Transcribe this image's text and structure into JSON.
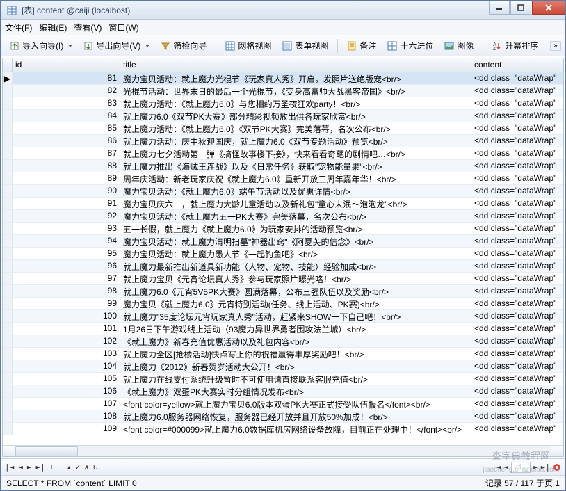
{
  "window": {
    "title": "[表] content @caiji (localhost)"
  },
  "menu": {
    "file": "文件(F)",
    "edit": "编辑(E)",
    "view": "查看(V)",
    "window": "窗口(W)"
  },
  "toolbar": {
    "import": "导入向导(I)",
    "export": "导出向导(V)",
    "filter": "筛检向导",
    "gridview": "网格视图",
    "formview": "表单视图",
    "memo": "备注",
    "hex": "十六进位",
    "image": "图像",
    "sort": "升幂排序"
  },
  "columns": {
    "id": "id",
    "title": "title",
    "content": "content"
  },
  "rows": [
    {
      "id": 81,
      "title": "魔力宝贝活动：就上魔力光棍节《玩家真人秀》开启，发照片送绝版宠<br/>",
      "content": "<dd class=\"dataWrap\""
    },
    {
      "id": 82,
      "title": "光棍节活动：世界末日的最后一个光棍节，《变身高富帅大战黑客帝国》<br/>",
      "content": "<dd class=\"dataWrap\""
    },
    {
      "id": 83,
      "title": "就上魔力活动：《就上魔力6.0》与您相约万圣夜狂欢party！<br/>",
      "content": "<dd class=\"dataWrap\""
    },
    {
      "id": 84,
      "title": "就上魔力6.0《双节PK大赛》部分精彩视频放出供各玩家欣赏<br/>",
      "content": "<dd class=\"dataWrap\""
    },
    {
      "id": 85,
      "title": "就上魔力活动：《就上魔力6.0》《双节PK大赛》完美落幕，名次公布<br/>",
      "content": "<dd class=\"dataWrap\""
    },
    {
      "id": 86,
      "title": "就上魔力活动：庆中秋迎国庆，就上魔力6.0《双节专题活动》预览<br/>",
      "content": "<dd class=\"dataWrap\""
    },
    {
      "id": 87,
      "title": "就上魔力七夕活动第一弹《搞怪故事楼下接》，快来看看奇葩的剧情吧…<br/>",
      "content": "<dd class=\"dataWrap\""
    },
    {
      "id": 88,
      "title": "就上魔力推出《海贼王连战》以及《日常任务》获取\"宠物能量果\"<br/>",
      "content": "<dd class=\"dataWrap\""
    },
    {
      "id": 89,
      "title": "周年庆活动：新老玩家庆祝《就上魔力6.0》重新开放三周年嘉年华！<br/>",
      "content": "<dd class=\"dataWrap\""
    },
    {
      "id": 90,
      "title": "魔力宝贝活动：《就上魔力6.0》端午节活动以及优惠详情<br/>",
      "content": "<dd class=\"dataWrap\""
    },
    {
      "id": 91,
      "title": "魔力宝贝庆六一，就上魔力大龄儿童活动以及新礼包\"童心未泯～泡泡龙\"<br/>",
      "content": "<dd class=\"dataWrap\""
    },
    {
      "id": 92,
      "title": "魔力宝贝活动：《就上魔力五一PK大赛》完美落幕，名次公布<br/>",
      "content": "<dd class=\"dataWrap\""
    },
    {
      "id": 93,
      "title": "五一长假，就上魔力《就上魔力6.0》为玩家安排的活动预览<br/>",
      "content": "<dd class=\"dataWrap\""
    },
    {
      "id": 94,
      "title": "魔力宝贝活动：就上魔力清明扫墓\"神器出窍\"《阿夏芙的信念》<br/>",
      "content": "<dd class=\"dataWrap\""
    },
    {
      "id": 95,
      "title": "魔力宝贝活动：就上魔力愚人节《一起钓鱼吧》<br/>",
      "content": "<dd class=\"dataWrap\""
    },
    {
      "id": 96,
      "title": "就上魔力最新推出新道具新功能（人物、宠物、技能）经验加成<br/>",
      "content": "<dd class=\"dataWrap\""
    },
    {
      "id": 97,
      "title": "就上魔力宝贝《元宵论坛真人秀》参与玩家照片曝光咯！<br/>",
      "content": "<dd class=\"dataWrap\""
    },
    {
      "id": 98,
      "title": "就上魔力6.0《元宵5V5PK大赛》圆满落幕，公布三强队伍以及奖励<br/>",
      "content": "<dd class=\"dataWrap\""
    },
    {
      "id": 99,
      "title": "魔力宝贝《就上魔力6.0》元宵特别活动(任务、线上活动、PK赛)<br/>",
      "content": "<dd class=\"dataWrap\""
    },
    {
      "id": 100,
      "title": "就上魔力\"35度论坛元宵玩家真人秀\"活动，赶紧来SHOW一下自己吧！<br/>",
      "content": "<dd class=\"dataWrap\""
    },
    {
      "id": 101,
      "title": "1月26日下午游戏线上活动（93魔力异世界勇者围攻法兰城）<br/>",
      "content": "<dd class=\"dataWrap\""
    },
    {
      "id": 102,
      "title": "《就上魔力》新春充值优惠活动以及礼包内容<br/>",
      "content": "<dd class=\"dataWrap\""
    },
    {
      "id": 103,
      "title": "就上魔力全区[抢楼活动]快点写上你的祝福赢得丰厚奖励吧！<br/>",
      "content": "<dd class=\"dataWrap\""
    },
    {
      "id": 104,
      "title": "就上魔力《2012》新春贺岁活动大公开！<br/>",
      "content": "<dd class=\"dataWrap\""
    },
    {
      "id": 105,
      "title": "就上魔力在线支付系统升级暂时不可使用请直接联系客服充值<br/>",
      "content": "<dd class=\"dataWrap\""
    },
    {
      "id": 106,
      "title": "《就上魔力》双蛋PK大赛实时分组情况发布<br/>",
      "content": "<dd class=\"dataWrap\""
    },
    {
      "id": 107,
      "title": "<font color=yellow>就上魔力宝贝6.0版本双蛋PK大赛正式接受队伍报名</font><br/>",
      "content": "<dd class=\"dataWrap\""
    },
    {
      "id": 108,
      "title": "就上魔力6.0服务器网络恢复，服务器已经开放并且开放50%加成！<br/>",
      "content": "<dd class=\"dataWrap\""
    },
    {
      "id": 109,
      "title": "<font color=#000099>就上魔力6.0数据库机房网络设备故障，目前正在处理中！</font><br/>",
      "content": "<dd class=\"dataWrap\""
    }
  ],
  "nav": {
    "page": "1"
  },
  "status": {
    "sql": "SELECT * FROM `content` LIMIT 0",
    "record": "记录 57 / 117 于页 1"
  },
  "watermark": {
    "main": "查字典教程网",
    "sub": "jiaocheng.chazidian.com"
  }
}
